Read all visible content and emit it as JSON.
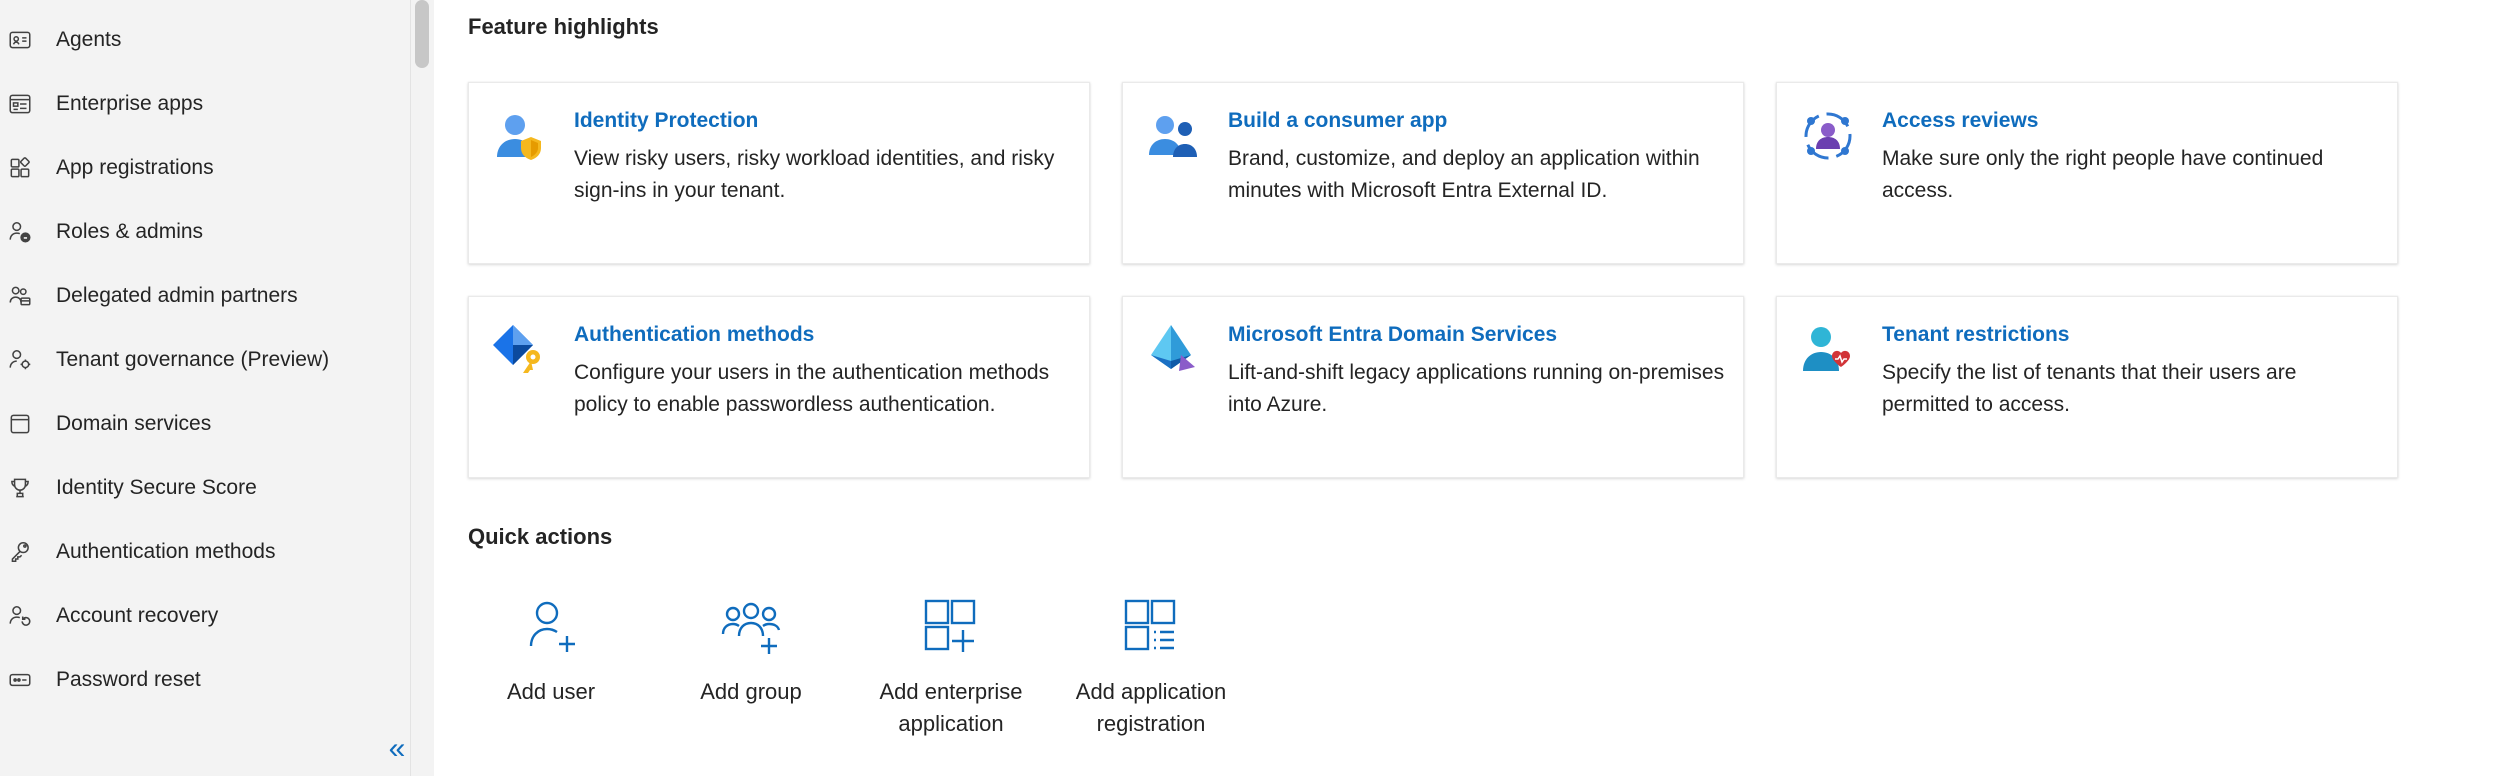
{
  "sidebar": {
    "items": [
      {
        "label": "Agents",
        "icon": "agents-icon"
      },
      {
        "label": "Enterprise apps",
        "icon": "enterprise-apps-icon"
      },
      {
        "label": "App registrations",
        "icon": "app-registrations-icon"
      },
      {
        "label": "Roles & admins",
        "icon": "roles-admins-icon"
      },
      {
        "label": "Delegated admin partners",
        "icon": "delegated-admin-icon"
      },
      {
        "label": "Tenant governance (Preview)",
        "icon": "tenant-governance-icon"
      },
      {
        "label": "Domain services",
        "icon": "domain-services-icon"
      },
      {
        "label": "Identity Secure Score",
        "icon": "trophy-icon"
      },
      {
        "label": "Authentication methods",
        "icon": "authentication-methods-icon"
      },
      {
        "label": "Account recovery",
        "icon": "account-recovery-icon"
      },
      {
        "label": "Password reset",
        "icon": "password-reset-icon"
      }
    ],
    "collapse_glyph": "«"
  },
  "features": {
    "title": "Feature highlights",
    "cards": [
      {
        "title": "Identity Protection",
        "desc": "View risky users, risky workload identities, and risky sign-ins in your tenant.",
        "icon": "identity-protection-icon"
      },
      {
        "title": "Build a consumer app",
        "desc": "Brand, customize, and deploy an application within minutes with Microsoft Entra External ID.",
        "icon": "consumer-app-icon"
      },
      {
        "title": "Access reviews",
        "desc": "Make sure only the right people have continued access.",
        "icon": "access-reviews-icon"
      },
      {
        "title": "Authentication methods",
        "desc": "Configure your users in the authentication methods policy to enable passwordless authentication.",
        "icon": "authentication-methods-icon"
      },
      {
        "title": "Microsoft Entra Domain Services",
        "desc": "Lift-and-shift legacy applications running on-premises into Azure.",
        "icon": "domain-services-icon"
      },
      {
        "title": "Tenant restrictions",
        "desc": "Specify the list of tenants that their users are permitted to access.",
        "icon": "tenant-restrictions-icon"
      }
    ]
  },
  "quick_actions": {
    "title": "Quick actions",
    "items": [
      {
        "label": "Add user",
        "icon": "add-user-icon"
      },
      {
        "label": "Add group",
        "icon": "add-group-icon"
      },
      {
        "label": "Add enterprise application",
        "icon": "add-enterprise-app-icon"
      },
      {
        "label": "Add application registration",
        "icon": "add-app-registration-icon"
      }
    ]
  },
  "colors": {
    "accent": "#0f6cbd",
    "sidebar_bg": "#f3f3f3",
    "text": "#242424"
  }
}
